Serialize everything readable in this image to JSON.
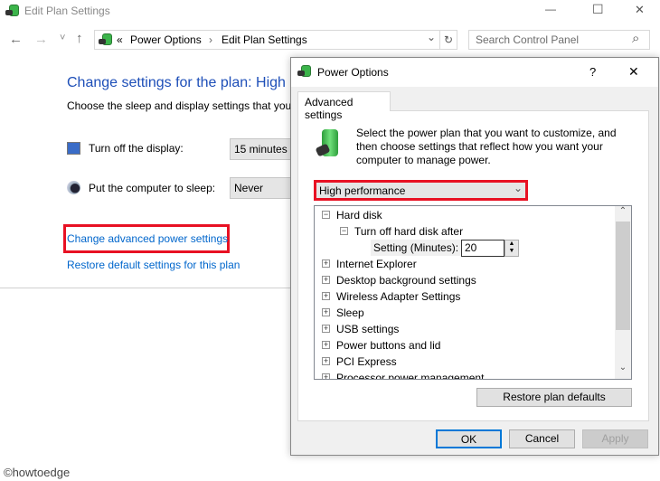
{
  "window": {
    "title": "Edit Plan Settings",
    "controls": {
      "minimize": "—",
      "maximize": "☐",
      "close": "✕"
    }
  },
  "nav": {
    "back": "←",
    "forward": "→",
    "recent": "˅",
    "up": "↑",
    "breadcrumb_prefix": "«",
    "breadcrumb": [
      "Power Options",
      "Edit Plan Settings"
    ],
    "separator": "›",
    "dropdown": "⌄",
    "refresh": "↻",
    "search_placeholder": "Search Control Panel",
    "search_icon": "⌕"
  },
  "main": {
    "heading": "Change settings for the plan: High p",
    "subheading": "Choose the sleep and display settings that you",
    "settings": [
      {
        "label": "Turn off the display:",
        "value": "15 minutes",
        "icon": "display-clock-icon"
      },
      {
        "label": "Put the computer to sleep:",
        "value": "Never",
        "icon": "moon-icon"
      }
    ],
    "links": {
      "advanced": "Change advanced power settings",
      "restore": "Restore default settings for this plan"
    },
    "highlight_color": "#e81123"
  },
  "dialog": {
    "title": "Power Options",
    "help": "?",
    "close": "✕",
    "tab": "Advanced settings",
    "intro": [
      "Select the power plan that you want to customize, and",
      "then choose settings that reflect how you want your",
      "computer to manage power."
    ],
    "plan": "High performance",
    "tree": [
      {
        "label": "Hard disk",
        "expanded": true,
        "level": 0
      },
      {
        "label": "Turn off hard disk after",
        "expanded": true,
        "level": 1
      },
      {
        "label": "Internet Explorer",
        "level": 0
      },
      {
        "label": "Desktop background settings",
        "level": 0
      },
      {
        "label": "Wireless Adapter Settings",
        "level": 0
      },
      {
        "label": "Sleep",
        "level": 0
      },
      {
        "label": "USB settings",
        "level": 0
      },
      {
        "label": "Power buttons and lid",
        "level": 0
      },
      {
        "label": "PCI Express",
        "level": 0
      },
      {
        "label": "Processor power management",
        "level": 0
      }
    ],
    "setting_label": "Setting (Minutes):",
    "setting_value": "20",
    "buttons": {
      "restore": "Restore plan defaults",
      "ok": "OK",
      "cancel": "Cancel",
      "apply": "Apply"
    }
  },
  "watermark": "©howtoedge"
}
